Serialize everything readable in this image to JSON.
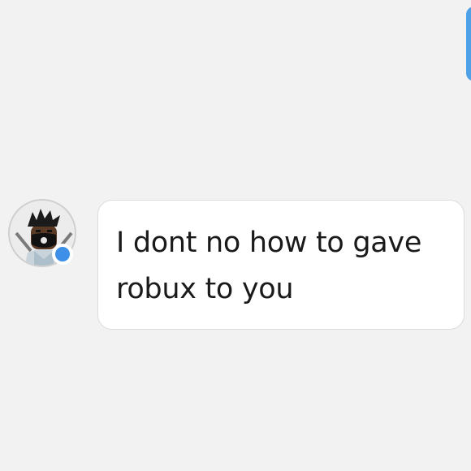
{
  "conversation": {
    "incoming_message": {
      "text": "I dont no how to gave robux to you",
      "sender_presence": "online"
    }
  },
  "colors": {
    "background": "#f2f2f2",
    "bubble": "#ffffff",
    "presence_dot": "#3d8fe8",
    "outgoing_bubble": "#4ea1e6"
  },
  "icons": {
    "avatar": "user-avatar-icon",
    "presence": "online-status-icon"
  }
}
